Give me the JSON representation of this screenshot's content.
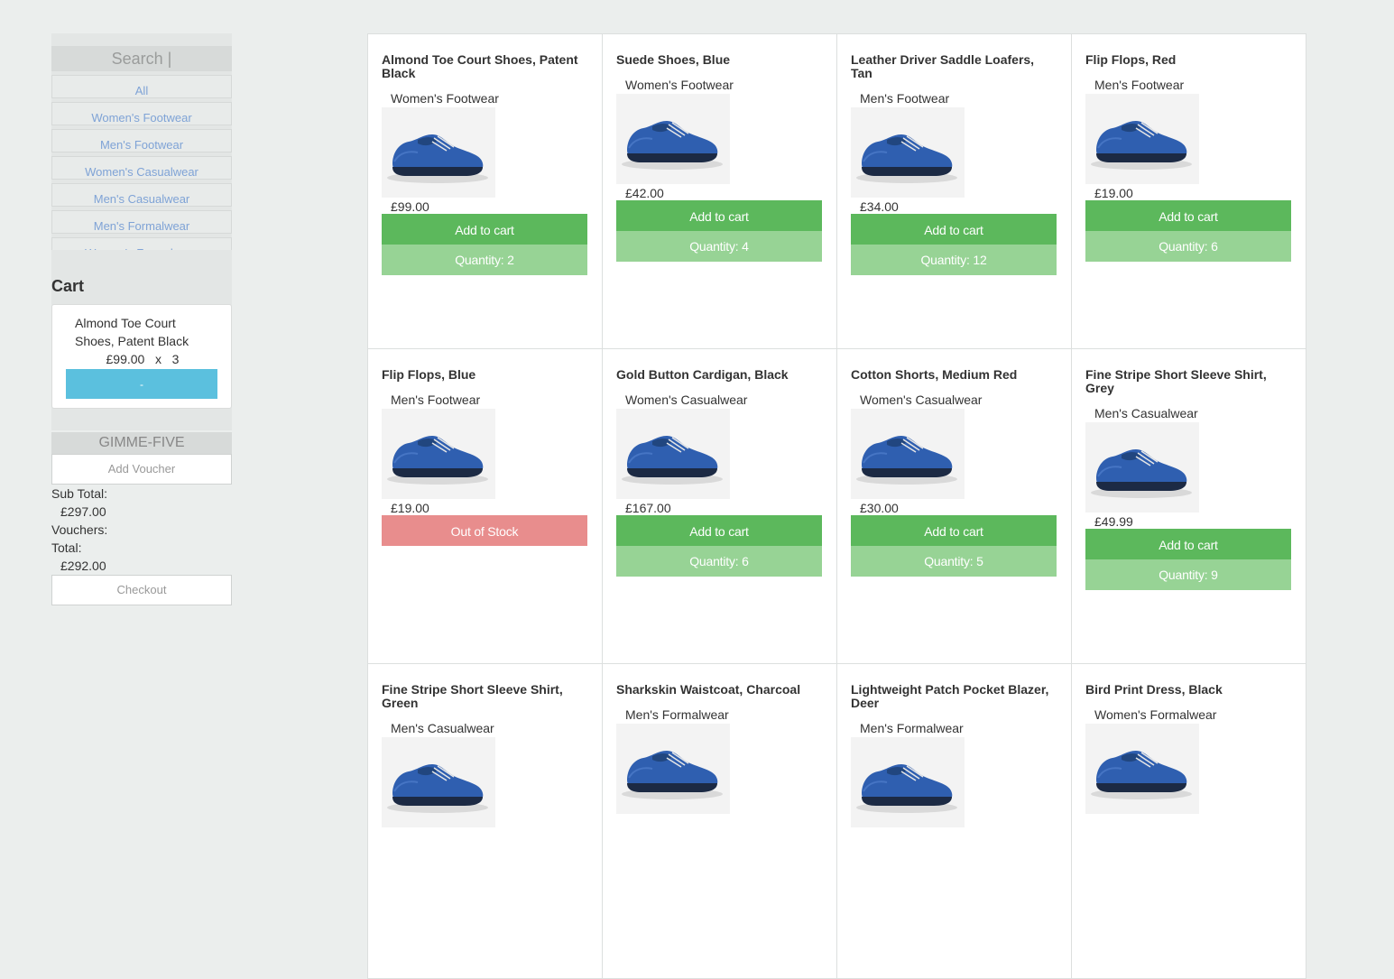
{
  "sidebar": {
    "search_placeholder": "Search |",
    "categories": [
      "All",
      "Women's Footwear",
      "Men's Footwear",
      "Women's Casualwear",
      "Men's Casualwear",
      "Men's Formalwear",
      "Women's Formalwear"
    ]
  },
  "cart": {
    "title": "Cart",
    "item_name": "Almond Toe Court Shoes, Patent Black",
    "item_price_line": "£99.00   x   3",
    "remove_label": "-",
    "voucher_code": "GIMME-FIVE",
    "voucher_button": "Add Voucher",
    "subtotal_label": "Sub Total:",
    "subtotal_value": "£297.00",
    "vouchers_label": "Vouchers:",
    "total_label": "Total:",
    "total_value": "£292.00",
    "checkout_label": "Checkout"
  },
  "products": [
    {
      "name": "Almond Toe Court Shoes, Patent Black",
      "category": "Women's Footwear",
      "price": "£99.00",
      "add_label": "Add to cart",
      "quantity": "Quantity: 2",
      "in_stock": true
    },
    {
      "name": "Suede Shoes, Blue",
      "category": "Women's Footwear",
      "price": "£42.00",
      "add_label": "Add to cart",
      "quantity": "Quantity: 4",
      "in_stock": true
    },
    {
      "name": "Leather Driver Saddle Loafers, Tan",
      "category": "Men's Footwear",
      "price": "£34.00",
      "add_label": "Add to cart",
      "quantity": "Quantity: 12",
      "in_stock": true
    },
    {
      "name": "Flip Flops, Red",
      "category": "Men's Footwear",
      "price": "£19.00",
      "add_label": "Add to cart",
      "quantity": "Quantity: 6",
      "in_stock": true
    },
    {
      "name": "Flip Flops, Blue",
      "category": "Men's Footwear",
      "price": "£19.00",
      "oos_label": "Out of Stock",
      "in_stock": false
    },
    {
      "name": "Gold Button Cardigan, Black",
      "category": "Women's Casualwear",
      "price": "£167.00",
      "add_label": "Add to cart",
      "quantity": "Quantity: 6",
      "in_stock": true
    },
    {
      "name": "Cotton Shorts, Medium Red",
      "category": "Women's Casualwear",
      "price": "£30.00",
      "add_label": "Add to cart",
      "quantity": "Quantity: 5",
      "in_stock": true
    },
    {
      "name": "Fine Stripe Short Sleeve Shirt, Grey",
      "category": "Men's Casualwear",
      "price": "£49.99",
      "add_label": "Add to cart",
      "quantity": "Quantity: 9",
      "in_stock": true
    },
    {
      "name": "Fine Stripe Short Sleeve Shirt, Green",
      "category": "Men's Casualwear",
      "in_stock": true
    },
    {
      "name": "Sharkskin Waistcoat, Charcoal",
      "category": "Men's Formalwear",
      "in_stock": true
    },
    {
      "name": "Lightweight Patch Pocket Blazer, Deer",
      "category": "Men's Formalwear",
      "in_stock": true
    },
    {
      "name": "Bird Print Dress, Black",
      "category": "Women's Formalwear",
      "in_stock": true
    }
  ],
  "colors": {
    "add_button": "#5cb85c",
    "quantity_button": "#97d395",
    "out_of_stock_button": "#e88d8d",
    "remove_button": "#5bc0de",
    "category_link": "#7fa3d6"
  }
}
